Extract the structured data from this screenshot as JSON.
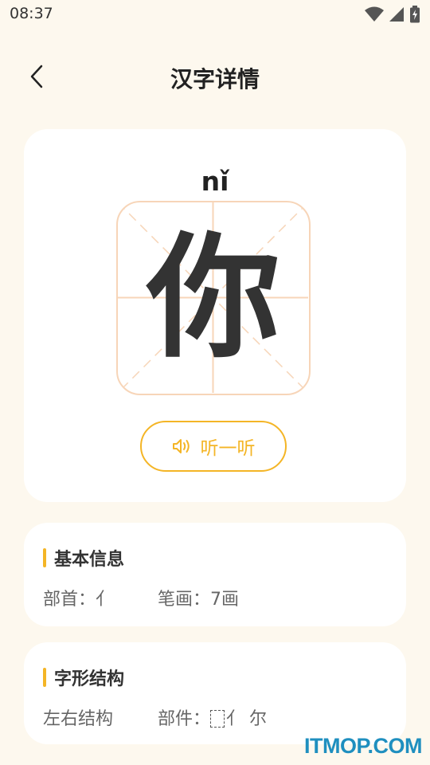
{
  "status_bar": {
    "time": "08:37",
    "icons": [
      "wifi-icon",
      "signal-icon",
      "battery-charging-icon"
    ]
  },
  "header": {
    "title": "汉字详情",
    "back_icon": "chevron-left-icon"
  },
  "character": {
    "pinyin": "nǐ",
    "hanzi": "你",
    "listen_label": "听一听",
    "listen_icon": "speaker-icon"
  },
  "basic_info": {
    "title": "基本信息",
    "radical_label": "部首：",
    "radical_value": "亻",
    "strokes_label": "笔画：",
    "strokes_value": "7画"
  },
  "structure": {
    "title": "字形结构",
    "type": "左右结构",
    "components_label": "部件：",
    "components_value": "亻 尔"
  },
  "watermark": "ITMOP.COM",
  "colors": {
    "background": "#fdf8ee",
    "accent": "#f4b526",
    "grid_line": "#f7d5b8",
    "text": "#333333"
  }
}
